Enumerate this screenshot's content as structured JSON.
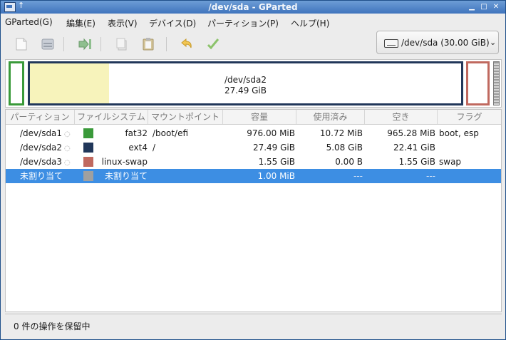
{
  "window": {
    "title": "/dev/sda - GParted"
  },
  "menu": [
    "GParted(G)",
    "編集(E)",
    "表示(V)",
    "デバイス(D)",
    "パーティション(P)",
    "ヘルプ(H)"
  ],
  "toolbar": {
    "icons": [
      "new-icon",
      "delete-icon",
      "resize-move-icon",
      "copy-icon",
      "paste-icon",
      "undo-icon",
      "apply-icon"
    ],
    "device": "/dev/sda (30.00 GiB)"
  },
  "partition_map": {
    "main_label": "/dev/sda2",
    "main_size": "27.49 GiB",
    "colors": {
      "fat32": "#3a9a3a",
      "ext4": "#21375a",
      "linux-swap": "#c0695f",
      "unallocated": "#a0a0a0",
      "used": "#f7f3bb"
    }
  },
  "table": {
    "columns": [
      "パーティション",
      "ファイルシステム",
      "マウントポイント",
      "容量",
      "使用済み",
      "空き",
      "フラグ"
    ],
    "rows": [
      {
        "partition": "/dev/sda1",
        "filesystem": "fat32",
        "mount": "/boot/efi",
        "size": "976.00 MiB",
        "used": "10.72 MiB",
        "free": "965.28 MiB",
        "flags": "boot, esp",
        "color": "#3a9a3a",
        "locked": true
      },
      {
        "partition": "/dev/sda2",
        "filesystem": "ext4",
        "mount": "/",
        "size": "27.49 GiB",
        "used": "5.08 GiB",
        "free": "22.41 GiB",
        "flags": "",
        "color": "#21375a",
        "locked": true
      },
      {
        "partition": "/dev/sda3",
        "filesystem": "linux-swap",
        "mount": "",
        "size": "1.55 GiB",
        "used": "0.00 B",
        "free": "1.55 GiB",
        "flags": "swap",
        "color": "#c0695f",
        "locked": true
      },
      {
        "partition": "未割り当て",
        "filesystem": "未割り当て",
        "mount": "",
        "size": "1.00 MiB",
        "used": "---",
        "free": "---",
        "flags": "",
        "color": "#a0a0a0",
        "locked": false,
        "selected": true
      }
    ]
  },
  "status": "0 件の操作を保留中"
}
